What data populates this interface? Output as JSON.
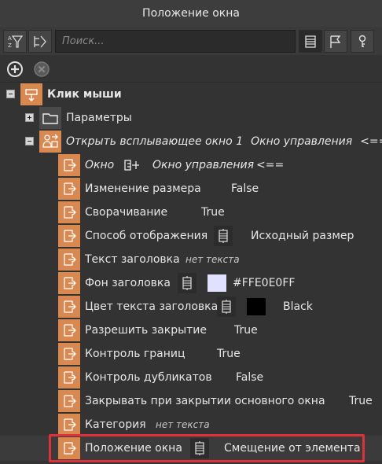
{
  "window": {
    "title": "Положение окна"
  },
  "search": {
    "placeholder": "Поиск..."
  },
  "tree": {
    "root": {
      "label": "Клик мыши"
    },
    "params": {
      "label": "Параметры"
    },
    "action": {
      "label": "Открыть всплывающее окно 1",
      "target": "Окно управления",
      "arrow": "<=="
    },
    "props": [
      {
        "label": "Окно",
        "value": "Окно управления",
        "arrow": "<==",
        "italic": true
      },
      {
        "label": "Изменение размера",
        "value": "False"
      },
      {
        "label": "Сворачивание",
        "value": "True"
      },
      {
        "label": "Способ отображения",
        "value": "Исходный размер"
      },
      {
        "label": "Текст заголовка",
        "value": "нет текста"
      },
      {
        "label": "Фон заголовка",
        "value": "#FFE0E0FF",
        "color": "#E0E0FF"
      },
      {
        "label": "Цвет текста заголовка",
        "value": "Black",
        "color": "#000000"
      },
      {
        "label": "Разрешить закрытие",
        "value": "True"
      },
      {
        "label": "Контроль границ",
        "value": "True"
      },
      {
        "label": "Контроль дубликатов",
        "value": "False"
      },
      {
        "label": "Закрывать при закрытии основного окна",
        "value": "True"
      },
      {
        "label": "Категория",
        "value": "нет текста"
      },
      {
        "label": "Положение окна",
        "value": "Смещение от элемента"
      }
    ]
  },
  "colors": {
    "accent_icon": "#D9884F",
    "highlight_border": "#E0313A"
  }
}
